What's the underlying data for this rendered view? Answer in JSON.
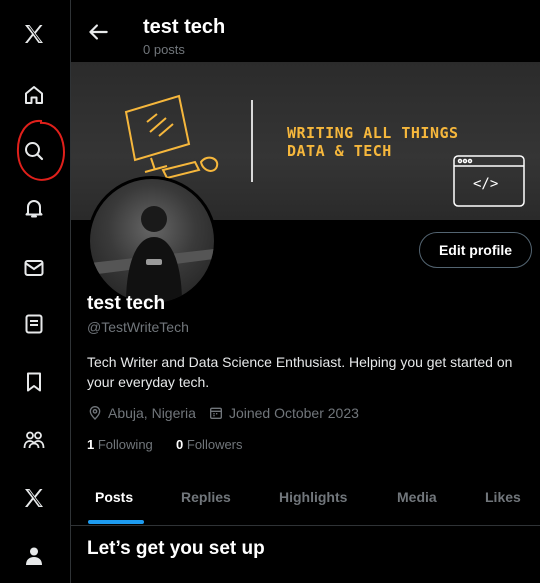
{
  "sidebar": {
    "items": [
      {
        "icon": "x-logo-icon"
      },
      {
        "icon": "home-icon"
      },
      {
        "icon": "search-icon"
      },
      {
        "icon": "notifications-bell-icon"
      },
      {
        "icon": "messages-envelope-icon"
      },
      {
        "icon": "lists-icon"
      },
      {
        "icon": "bookmarks-icon"
      },
      {
        "icon": "communities-icon"
      },
      {
        "icon": "premium-x-icon"
      },
      {
        "icon": "profile-person-icon"
      }
    ],
    "annotation_color": "#e0201b"
  },
  "header": {
    "title": "test tech",
    "post_count": "0 posts"
  },
  "banner": {
    "line1": "WRITING ALL THINGS",
    "line2": "DATA & TECH",
    "code_symbol": "</>",
    "accent": "#f6b73c"
  },
  "profile": {
    "edit_label": "Edit profile",
    "name": "test tech",
    "handle": "@TestWriteTech",
    "bio": "Tech Writer and Data Science Enthusiast. Helping you get started on your everyday tech.",
    "location": "Abuja, Nigeria",
    "joined": "Joined October 2023",
    "following_count": "1",
    "following_label": "Following",
    "followers_count": "0",
    "followers_label": "Followers"
  },
  "tabs": [
    {
      "label": "Posts",
      "active": true
    },
    {
      "label": "Replies"
    },
    {
      "label": "Highlights"
    },
    {
      "label": "Media"
    },
    {
      "label": "Likes"
    }
  ],
  "setup": {
    "heading": "Let’s get you set up"
  },
  "colors": {
    "background": "#000000",
    "text": "#e7e9ea",
    "muted": "#71767b",
    "accent_blue": "#1d9bf0",
    "border": "#2f3336"
  }
}
